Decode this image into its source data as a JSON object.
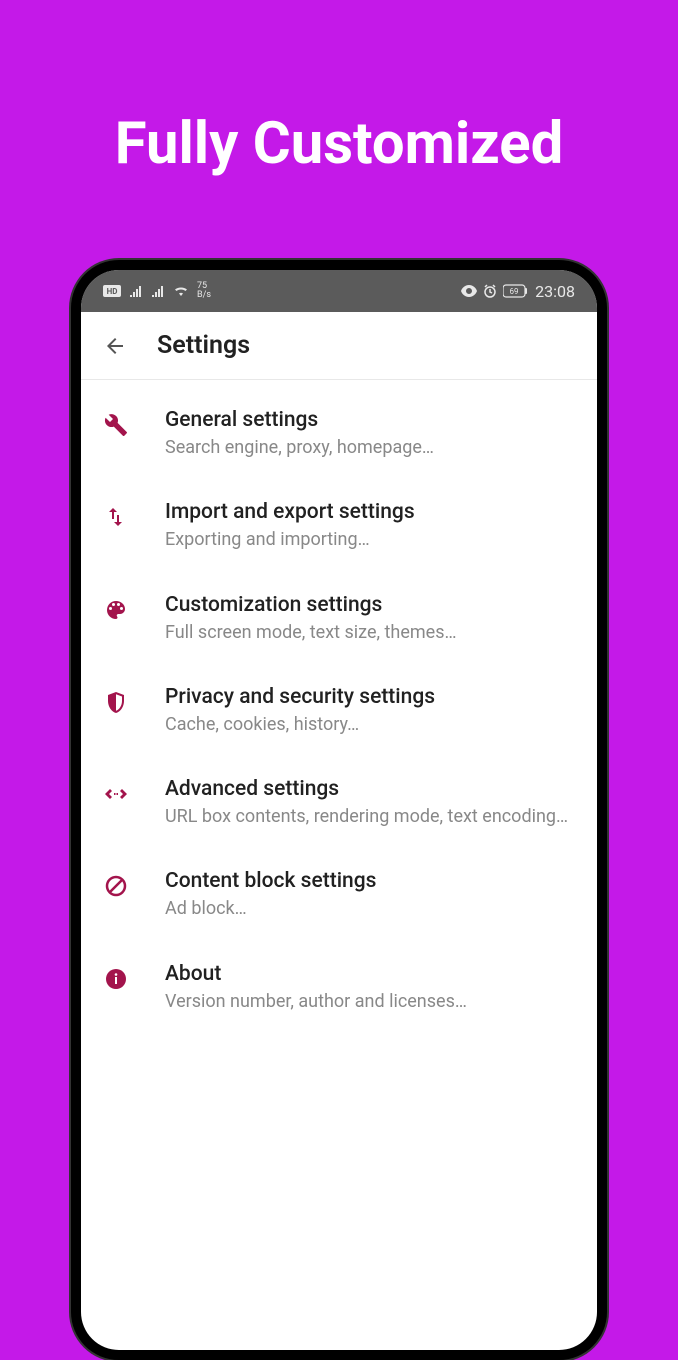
{
  "promo": {
    "title": "Fully Customized"
  },
  "status_bar": {
    "hd_label": "HD",
    "speed_num": "75",
    "speed_unit": "B/s",
    "battery": "69",
    "time": "23:08"
  },
  "header": {
    "title": "Settings"
  },
  "items": [
    {
      "icon": "wrench-icon",
      "title": "General settings",
      "subtitle": "Search engine, proxy, homepage…"
    },
    {
      "icon": "import-export-icon",
      "title": "Import and export settings",
      "subtitle": "Exporting and importing…"
    },
    {
      "icon": "palette-icon",
      "title": "Customization settings",
      "subtitle": "Full screen mode, text size, themes…"
    },
    {
      "icon": "shield-icon",
      "title": "Privacy and security settings",
      "subtitle": "Cache, cookies, history…"
    },
    {
      "icon": "code-icon",
      "title": "Advanced settings",
      "subtitle": "URL box contents, rendering mode, text encoding…"
    },
    {
      "icon": "block-icon",
      "title": "Content block settings",
      "subtitle": "Ad block…"
    },
    {
      "icon": "info-icon",
      "title": "About",
      "subtitle": "Version number, author and licenses…"
    }
  ]
}
